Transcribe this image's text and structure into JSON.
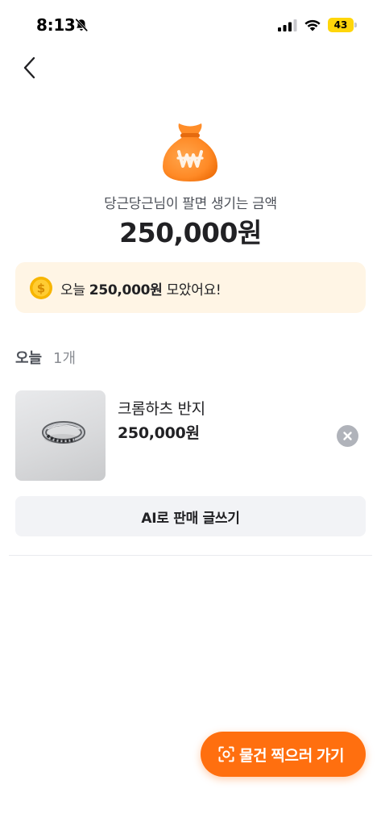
{
  "status_bar": {
    "time": "8:13",
    "battery": "43",
    "icons": [
      "bell-slash-icon",
      "cellular-signal-icon",
      "wifi-icon",
      "battery-icon"
    ]
  },
  "nav": {
    "back_icon": "chevron-left-icon"
  },
  "hero": {
    "icon": "money-bag-icon",
    "caption": "당근당근님이 팔면 생기는 금액",
    "amount": "250,000원"
  },
  "banner": {
    "icon": "coin-icon",
    "prefix": "오늘 ",
    "amount": "250,000원",
    "suffix": " 모았어요!"
  },
  "section": {
    "title": "오늘",
    "count": "1개"
  },
  "items": [
    {
      "name": "크롬하츠 반지",
      "price": "250,000원",
      "remove_icon": "close-circle-icon"
    }
  ],
  "ai_write_button": {
    "label": "AI로 판매 글쓰기"
  },
  "fab": {
    "icon": "scan-camera-icon",
    "label": "물건 찍으러 가기"
  },
  "colors": {
    "accent": "#ff6f0f",
    "banner_bg": "#fff5e5",
    "button_bg": "#f2f3f6",
    "battery": "#ffd60a"
  }
}
